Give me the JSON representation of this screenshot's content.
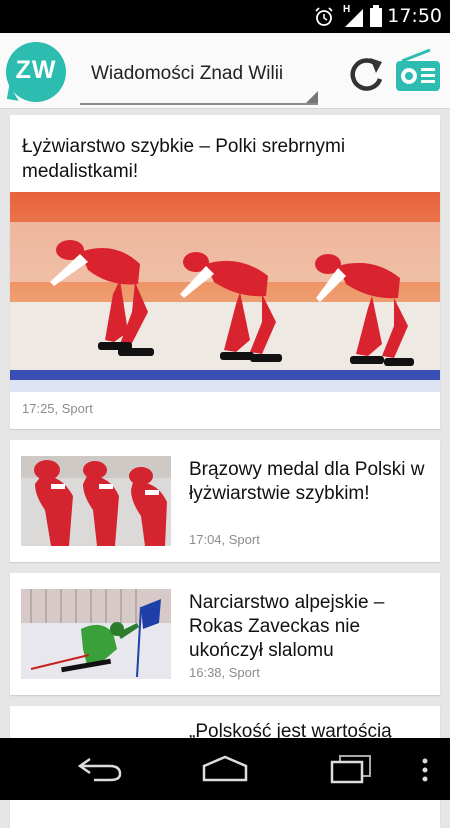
{
  "status_bar": {
    "time": "17:50",
    "signal_label": "H",
    "icons": [
      "alarm-icon",
      "signal-icon",
      "battery-icon"
    ]
  },
  "app_bar": {
    "logo_text": "ZW",
    "source_selector": "Wiadomości Znad Wilii",
    "icons": [
      "refresh-icon",
      "radio-icon"
    ],
    "accent_color": "#2cbcb0"
  },
  "feed": {
    "featured": {
      "title": "Łyżwiarstwo szybkie – Polki srebrnymi medalistkami!",
      "meta": "17:25, Sport",
      "image": "speed-skating-team-image"
    },
    "items": [
      {
        "title": "Brązowy medal dla Polski w łyżwiarstwie szybkim!",
        "meta": "17:04, Sport",
        "image": "speed-skaters-thumbnail"
      },
      {
        "title": "Narciarstwo alpejskie – Rokas Zaveckas nie ukończył slalomu",
        "meta": "16:38, Sport",
        "image": "slalom-skier-thumbnail"
      },
      {
        "title": "„Polskość jest wartością",
        "meta": "",
        "image": ""
      }
    ]
  },
  "nav_bar": {
    "icons": [
      "back-icon",
      "home-icon",
      "recent-apps-icon",
      "overflow-menu-icon"
    ]
  }
}
